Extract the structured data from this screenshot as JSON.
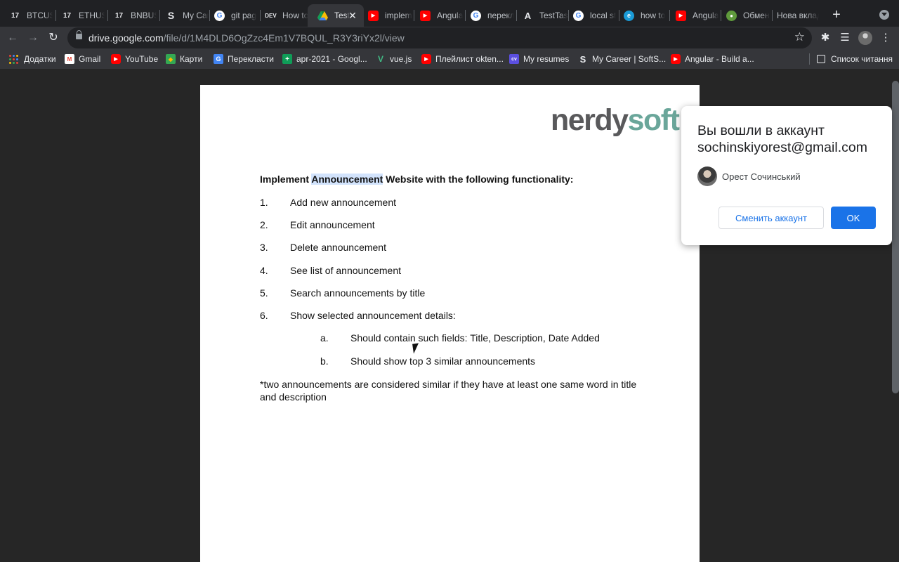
{
  "tabs": [
    {
      "title": "BTCUS",
      "icon": "tradingview-icon"
    },
    {
      "title": "ETHUS",
      "icon": "tradingview-icon"
    },
    {
      "title": "BNBUS",
      "icon": "tradingview-icon"
    },
    {
      "title": "My Car",
      "icon": "softserve-icon"
    },
    {
      "title": "git pag",
      "icon": "google-icon"
    },
    {
      "title": "How to",
      "icon": "dev-icon"
    },
    {
      "title": "Test",
      "icon": "google-drive-icon",
      "active": true
    },
    {
      "title": "implem",
      "icon": "youtube-icon"
    },
    {
      "title": "Angula",
      "icon": "youtube-icon"
    },
    {
      "title": "перекл",
      "icon": "google-icon"
    },
    {
      "title": "TestTas",
      "icon": "notion-icon"
    },
    {
      "title": "local st",
      "icon": "google-icon"
    },
    {
      "title": "how to",
      "icon": "edge-icon"
    },
    {
      "title": "Angula",
      "icon": "youtube-icon"
    },
    {
      "title": "Обмен",
      "icon": "frog-icon"
    },
    {
      "title": "Нова вклад",
      "icon": ""
    }
  ],
  "address": {
    "domain": "drive.google.com",
    "path": "/file/d/1M4DLD6OgZzc4Em1V7BQUL_R3Y3riYx2l/view"
  },
  "bookmarks": [
    {
      "label": "Додатки",
      "icon": "apps-icon"
    },
    {
      "label": "Gmail",
      "icon": "gmail-icon"
    },
    {
      "label": "YouTube",
      "icon": "youtube-icon"
    },
    {
      "label": "Карти",
      "icon": "maps-icon"
    },
    {
      "label": "Перекласти",
      "icon": "translate-icon"
    },
    {
      "label": "apr-2021 - Googl...",
      "icon": "sheets-icon"
    },
    {
      "label": "vue.js",
      "icon": "vue-icon"
    },
    {
      "label": "Плейлист okten...",
      "icon": "youtube-icon"
    },
    {
      "label": "My resumes",
      "icon": "cv-icon"
    },
    {
      "label": "My Career | SoftS...",
      "icon": "softserve-icon"
    },
    {
      "label": "Angular - Build a...",
      "icon": "youtube-icon"
    }
  ],
  "reading_list": "Список читання",
  "document": {
    "logo_part1": "nerdy",
    "logo_part2": "soft",
    "heading_pre": "Implement ",
    "heading_highlight": "Announcement",
    "heading_post": " Website with the following functionality:",
    "items": [
      {
        "num": "1.",
        "text": "Add new announcement"
      },
      {
        "num": "2.",
        "text": "Edit announcement"
      },
      {
        "num": "3.",
        "text": "Delete announcement"
      },
      {
        "num": "4.",
        "text": "See list of announcement"
      },
      {
        "num": "5.",
        "text": "Search announcements by title"
      },
      {
        "num": "6.",
        "text": "Show selected announcement details:"
      }
    ],
    "subitems": [
      {
        "num": "a.",
        "text": "Should contain such fields: Title, Description,  Date Added"
      },
      {
        "num": "b.",
        "text": "Should show top 3 similar announcements"
      }
    ],
    "footnote": "*two announcements are considered similar if they have at least one same word in title and description"
  },
  "popup": {
    "title_line1": "Вы вошли в аккаунт",
    "title_line2": "sochinskiyorest@gmail.com",
    "user_name": "Орест Сочинський",
    "switch_label": "Сменить аккаунт",
    "ok_label": "OK"
  },
  "colors": {
    "accent": "#1a73e8",
    "logo_gray": "#59595b",
    "logo_green": "#6aa69a"
  }
}
